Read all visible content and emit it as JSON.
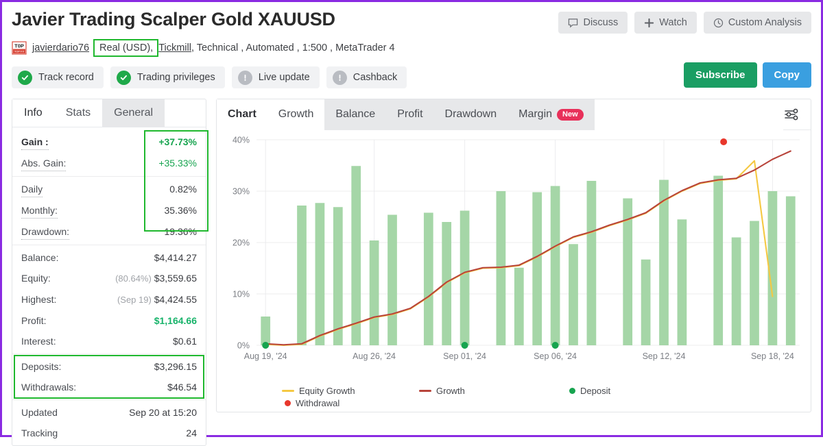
{
  "header": {
    "title": "Javier Trading Scalper Gold XAUUSD",
    "actions": [
      {
        "label": "Discuss",
        "icon": "comment-icon"
      },
      {
        "label": "Watch",
        "icon": "plus-icon"
      },
      {
        "label": "Custom Analysis",
        "icon": "clock-icon"
      }
    ],
    "meta": {
      "badge_icon": "top-badge-icon",
      "username": "javierdario76",
      "account_type": "Real (USD),",
      "broker": "Tickmill",
      "rest": " , Technical , Automated , 1:500 , MetaTrader 4"
    },
    "badges": [
      {
        "label": "Track record",
        "state": "ok"
      },
      {
        "label": "Trading privileges",
        "state": "ok"
      },
      {
        "label": "Live update",
        "state": "warn"
      },
      {
        "label": "Cashback",
        "state": "warn"
      }
    ],
    "cta": {
      "subscribe": "Subscribe",
      "copy": "Copy"
    }
  },
  "sidebar": {
    "tabs": [
      {
        "label": "Info",
        "active": true,
        "grey": false
      },
      {
        "label": "Stats",
        "active": false,
        "grey": false
      },
      {
        "label": "General",
        "active": false,
        "grey": true
      }
    ],
    "group1": [
      {
        "label": "Gain :",
        "value": "+37.73%",
        "style": "green",
        "bold": true
      },
      {
        "label": "Abs. Gain:",
        "value": "+35.33%",
        "style": "green-n",
        "bold": false
      }
    ],
    "group2": [
      {
        "label": "Daily",
        "value": "0.82%",
        "style": "",
        "bold": false
      },
      {
        "label": "Monthly:",
        "value": "35.36%",
        "style": "",
        "bold": false
      },
      {
        "label": "Drawdown:",
        "value": "19.36%",
        "style": "",
        "bold": false
      }
    ],
    "group3": [
      {
        "label": "Balance:",
        "value": "$4,414.27",
        "sub": "",
        "style": ""
      },
      {
        "label": "Equity:",
        "value": "$3,559.65",
        "sub": "(80.64%)",
        "style": ""
      },
      {
        "label": "Highest:",
        "value": "$4,424.55",
        "sub": "(Sep 19)",
        "style": ""
      },
      {
        "label": "Profit:",
        "value": "$1,164.66",
        "sub": "",
        "style": "mint"
      },
      {
        "label": "Interest:",
        "value": "$0.61",
        "sub": "",
        "style": ""
      }
    ],
    "group4": [
      {
        "label": "Deposits:",
        "value": "$3,296.15"
      },
      {
        "label": "Withdrawals:",
        "value": "$46.54"
      }
    ],
    "group5": [
      {
        "label": "Updated",
        "value": "Sep 20 at 15:20"
      },
      {
        "label": "Tracking",
        "value": "24"
      }
    ]
  },
  "chart_panel": {
    "tabs": [
      {
        "label": "Chart",
        "active": true,
        "badge": ""
      },
      {
        "label": "Growth",
        "active": false,
        "plain": true,
        "badge": ""
      },
      {
        "label": "Balance",
        "active": false,
        "badge": ""
      },
      {
        "label": "Profit",
        "active": false,
        "badge": ""
      },
      {
        "label": "Drawdown",
        "active": false,
        "badge": ""
      },
      {
        "label": "Margin",
        "active": false,
        "badge": "New"
      }
    ],
    "settings_icon": "sliders-icon"
  },
  "chart_data": {
    "type": "bar",
    "title": "",
    "xlabel": "",
    "ylabel": "",
    "ylim": [
      0,
      40
    ],
    "ytick_labels": [
      "0%",
      "10%",
      "20%",
      "30%",
      "40%"
    ],
    "yticks": [
      0,
      10,
      20,
      30,
      40
    ],
    "grid": true,
    "legend_position": "bottom",
    "xtick_labels": [
      "Aug 19, '24",
      "Aug 26, '24",
      "Sep 01, '24",
      "Sep 06, '24",
      "Sep 12, '24",
      "Sep 18, '24"
    ],
    "xtick_positions": [
      0,
      6,
      11,
      16,
      22,
      28
    ],
    "bar_color": "#a5d6a7",
    "bars": {
      "name": "Daily Growth",
      "values": [
        5.6,
        0,
        27.2,
        27.7,
        26.9,
        34.9,
        20.4,
        25.4,
        0,
        25.8,
        24.0,
        26.2,
        0,
        30.0,
        15.1,
        29.8,
        31.0,
        19.7,
        32.0,
        0,
        28.6,
        16.7,
        32.2,
        24.5,
        0,
        33.0,
        21.0,
        24.2,
        30.0,
        29.0
      ]
    },
    "series": [
      {
        "name": "Growth",
        "color": "#b8443b",
        "type": "line",
        "x": [
          0,
          1,
          2,
          3,
          4,
          5,
          6,
          7,
          8,
          9,
          10,
          11,
          12,
          13,
          14,
          15,
          16,
          17,
          18,
          19,
          20,
          21,
          22,
          23,
          24,
          25,
          26,
          27,
          28,
          29
        ],
        "values": [
          0.3,
          0.1,
          0.3,
          1.9,
          3.2,
          4.3,
          5.5,
          6.1,
          7.2,
          9.5,
          12.3,
          14.2,
          15.1,
          15.2,
          15.6,
          17.3,
          19.3,
          21.1,
          22.1,
          23.4,
          24.5,
          25.8,
          28.2,
          30.1,
          31.6,
          32.2,
          32.5,
          34.1,
          36.2,
          37.8
        ]
      },
      {
        "name": "Equity Growth",
        "color": "#f5c842",
        "type": "line",
        "x": [
          0,
          1,
          2,
          3,
          4,
          5,
          6,
          7,
          8,
          9,
          10,
          11,
          12,
          13,
          14,
          15,
          16,
          17,
          18,
          19,
          20,
          21,
          22,
          23,
          24,
          25,
          26,
          27,
          28
        ],
        "values": [
          0.2,
          0.0,
          0.2,
          1.8,
          3.1,
          4.2,
          5.4,
          6.0,
          7.1,
          9.4,
          12.2,
          14.1,
          15.0,
          15.1,
          15.5,
          17.2,
          19.2,
          21.0,
          22.0,
          23.3,
          24.4,
          25.7,
          28.1,
          30.0,
          31.5,
          32.1,
          32.4,
          35.9,
          9.5
        ]
      }
    ],
    "markers": [
      {
        "name": "Deposit",
        "color": "#17a44f",
        "points": [
          {
            "x": 0,
            "y": 0
          },
          {
            "x": 11,
            "y": 0
          },
          {
            "x": 16,
            "y": 0
          }
        ]
      },
      {
        "name": "Withdrawal",
        "color": "#e8372c",
        "points": [
          {
            "x": 25.3,
            "y": 39.6
          }
        ]
      }
    ],
    "legend": [
      {
        "label": "Equity Growth",
        "color": "#f5c842",
        "marker": "line"
      },
      {
        "label": "Growth",
        "color": "#b8443b",
        "marker": "line"
      },
      {
        "label": "Deposit",
        "color": "#17a44f",
        "marker": "dot"
      },
      {
        "label": "Withdrawal",
        "color": "#e8372c",
        "marker": "dot"
      }
    ]
  }
}
